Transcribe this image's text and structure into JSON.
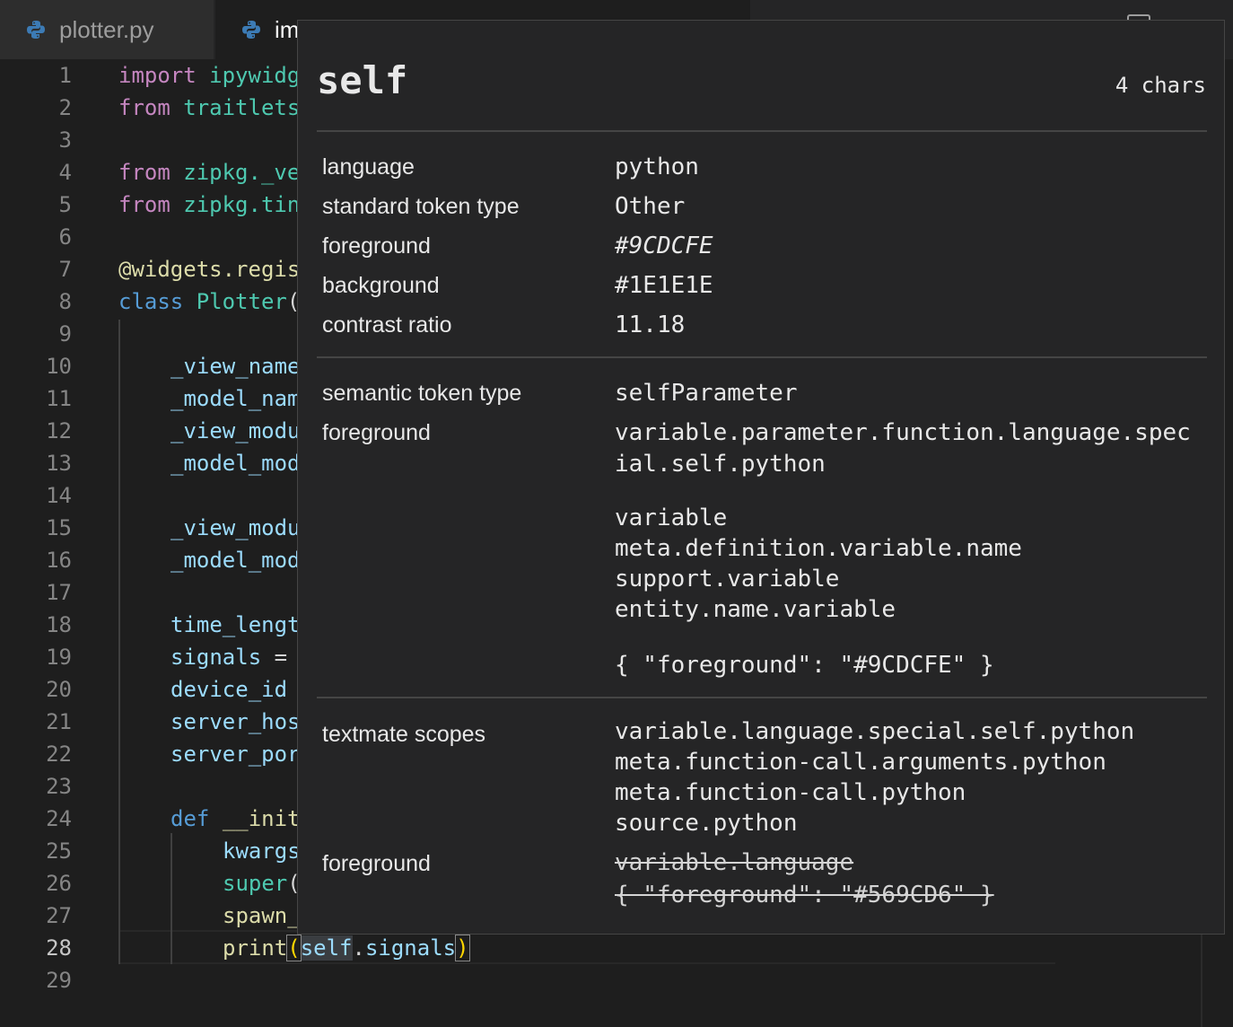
{
  "tabs": [
    {
      "label": "plotter.py",
      "icon": "python-icon",
      "active": false
    },
    {
      "label": "im",
      "icon": "python-icon",
      "active": true
    }
  ],
  "editor": {
    "line_numbers": [
      "1",
      "2",
      "3",
      "4",
      "5",
      "6",
      "7",
      "8",
      "9",
      "10",
      "11",
      "12",
      "13",
      "14",
      "15",
      "16",
      "17",
      "18",
      "19",
      "20",
      "21",
      "22",
      "23",
      "24",
      "25",
      "26",
      "27",
      "28",
      "29"
    ],
    "current_line": "28",
    "lines": {
      "l1": {
        "kw": "import",
        "rest": "ipywidg"
      },
      "l2": {
        "kw": "from",
        "rest": "traitlets"
      },
      "l4": {
        "kw": "from",
        "mod": "zipkg",
        "rest": "._ve"
      },
      "l5": {
        "kw": "from",
        "mod": "zipkg",
        "rest": ".tin"
      },
      "l7": {
        "dec": "@widgets",
        "rest": ".regis"
      },
      "l8": {
        "kw": "class",
        "cls": "Plotter",
        "rest": "("
      },
      "l10": "_view_name",
      "l11": "_model_nam",
      "l12": "_view_modu",
      "l13": "_model_mod",
      "l15": "_view_modu",
      "l16": "_model_mod",
      "l18": "time_lengt",
      "l19": {
        "var": "signals",
        "rest": " ="
      },
      "l20": "device_id",
      "l21": "server_hos",
      "l22": "server_por",
      "l24": {
        "kw": "def",
        "fn": "__init"
      },
      "l25": "kwargs",
      "l26": {
        "fn": "super",
        "rest": "("
      },
      "l27": "spawn_",
      "l28": {
        "fn": "print",
        "open": "(",
        "self": "self",
        "dot": ".",
        "attr": "signals",
        "close": ")"
      }
    }
  },
  "inspector": {
    "title": "self",
    "chars": "4 chars",
    "section1": {
      "language_label": "language",
      "language_value": "python",
      "std_type_label": "standard token type",
      "std_type_value": "Other",
      "fg_label": "foreground",
      "fg_value": "#9CDCFE",
      "bg_label": "background",
      "bg_value": "#1E1E1E",
      "contrast_label": "contrast ratio",
      "contrast_value": "11.18"
    },
    "section2": {
      "sem_label": "semantic token type",
      "sem_value": "selfParameter",
      "fg_label": "foreground",
      "fg_scope_line1": "variable.parameter.function.language.spec",
      "fg_scope_line2": "ial.self.python",
      "rules": [
        "variable",
        "meta.definition.variable.name",
        "support.variable",
        "entity.name.variable"
      ],
      "rule_value": "{ \"foreground\": \"#9CDCFE\" }"
    },
    "section3": {
      "tm_label": "textmate scopes",
      "scopes": [
        "variable.language.special.self.python",
        "meta.function-call.arguments.python",
        "meta.function-call.python",
        "source.python"
      ],
      "fg_label": "foreground",
      "fg_struck1": "variable.language",
      "fg_struck2": "{ \"foreground\": \"#569CD6\" }"
    }
  },
  "colors": {
    "keyword": "#c586c0",
    "keyword_blue": "#569cd6",
    "module": "#4ec9b0",
    "variable": "#9cdcfe",
    "function": "#dcdcaa",
    "background": "#1e1e1e",
    "hover_bg": "#252526"
  }
}
